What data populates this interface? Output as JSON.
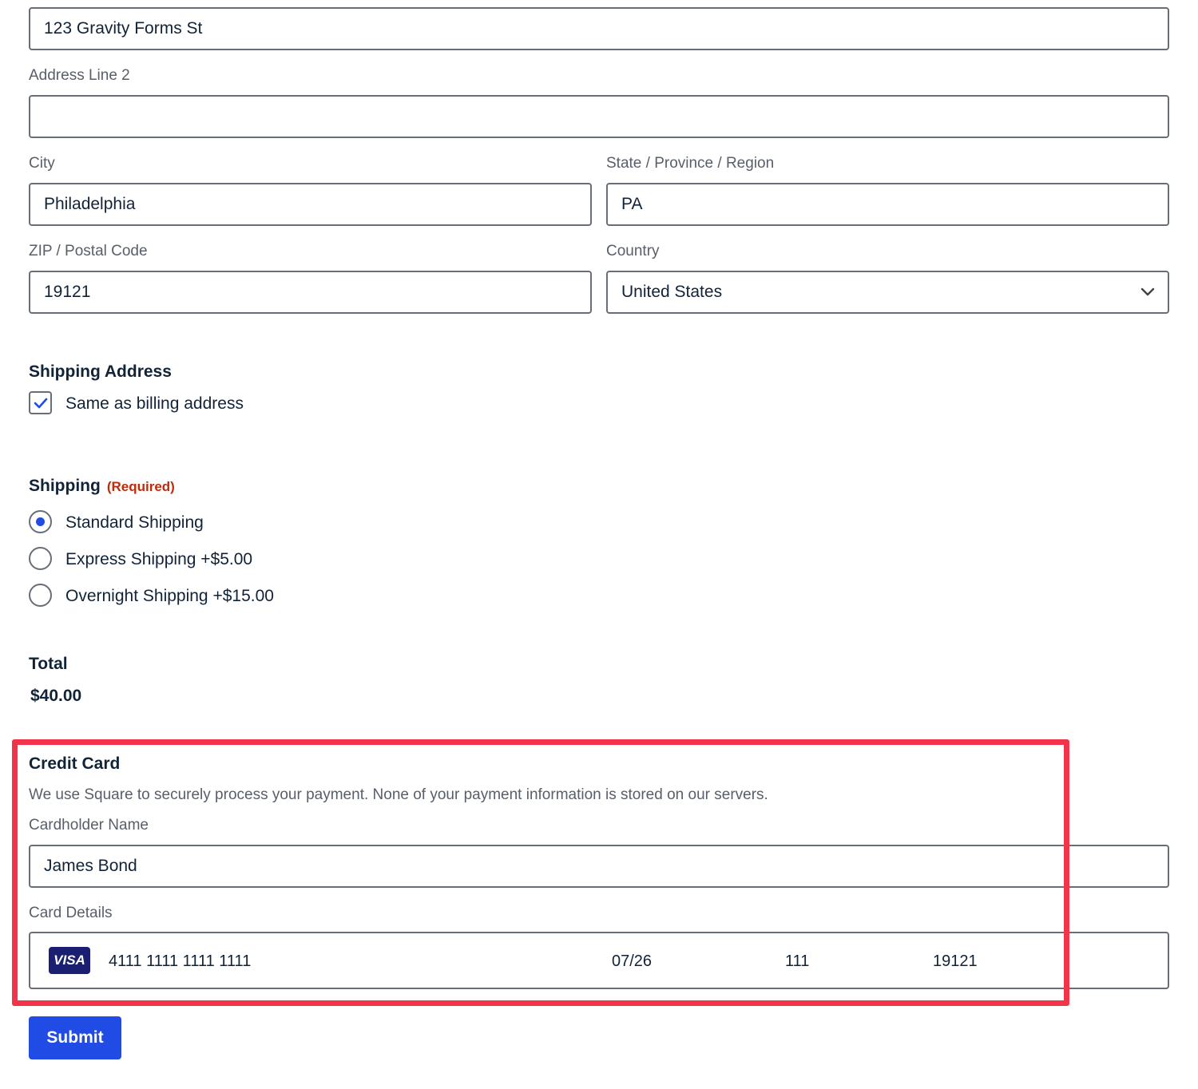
{
  "billing": {
    "address_line1_value": "123 Gravity Forms St",
    "address_line2_label": "Address Line 2",
    "address_line2_value": "",
    "city_label": "City",
    "city_value": "Philadelphia",
    "state_label": "State / Province / Region",
    "state_value": "PA",
    "zip_label": "ZIP / Postal Code",
    "zip_value": "19121",
    "country_label": "Country",
    "country_value": "United States",
    "country_icon": "chevron-down-icon"
  },
  "shipping_address": {
    "title": "Shipping Address",
    "same_as_billing_label": "Same as billing address",
    "same_as_billing_checked": true
  },
  "shipping": {
    "title": "Shipping",
    "required_label": "(Required)",
    "options": [
      {
        "label": "Standard Shipping",
        "selected": true
      },
      {
        "label": "Express Shipping +$5.00",
        "selected": false
      },
      {
        "label": "Overnight Shipping +$15.00",
        "selected": false
      }
    ]
  },
  "total": {
    "title": "Total",
    "value": "$40.00"
  },
  "credit_card": {
    "title": "Credit Card",
    "description": "We use Square to securely process your payment. None of your payment information is stored on our servers.",
    "cardholder_label": "Cardholder Name",
    "cardholder_value": "James Bond",
    "details_label": "Card Details",
    "brand": "VISA",
    "number": "4111 1111 1111 1111",
    "expiry": "07/26",
    "cvv": "111",
    "postal": "19121"
  },
  "submit_label": "Submit",
  "colors": {
    "accent": "#204ce5",
    "required": "#c02b0a",
    "highlight": "#f2344b",
    "visa": "#1a1f71"
  }
}
